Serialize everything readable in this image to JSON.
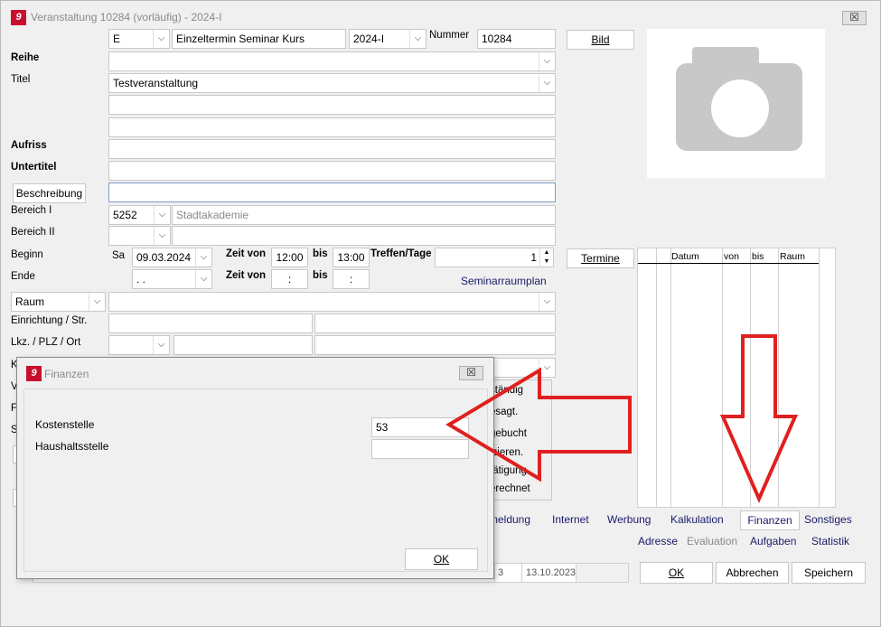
{
  "window": {
    "title": "Veranstaltung 10284 (vorläufig) - 2024-I",
    "close_label": "☒"
  },
  "header_row": {
    "kind": "E",
    "type": "Einzeltermin Seminar Kurs",
    "semester": "2024-I",
    "nummer_label": "Nummer",
    "nummer": "10284",
    "bild_label": "Bild"
  },
  "labels": {
    "reihe": "Reihe",
    "titel": "Titel",
    "aufriss": "Aufriss",
    "untertitel": "Untertitel",
    "beschreibung": "Beschreibung",
    "bereich1": "Bereich I",
    "bereich2": "Bereich II",
    "beginn": "Beginn",
    "ende": "Ende",
    "zeit_von": "Zeit von",
    "bis": "bis",
    "treffen": "Treffen/Tage",
    "termine": "Termine",
    "seminarraumplan": "Seminarraumplan",
    "raum": "Raum",
    "einrichtung": "Einrichtung / Str.",
    "plz": "Lkz. / PLZ / Ort"
  },
  "values": {
    "titel": "Testveranstaltung",
    "bereich1_code": "5252",
    "bereich1_name": "Stadtakademie",
    "beginn_day": "Sa",
    "beginn_date": "09.03.2024",
    "beginn_from": "12:00",
    "beginn_to": "13:00",
    "treffen": "1",
    "ende_date": " .  .",
    "ende_from": ":",
    "ende_to": ":"
  },
  "termin_grid": {
    "columns": [
      "Datum",
      "von",
      "bis",
      "Raum"
    ]
  },
  "status_items": [
    "ständig",
    "esagt.",
    "gebucht",
    "izieren.",
    "tätigung",
    "erechnet"
  ],
  "tabs_row1": [
    "meldung",
    "Internet",
    "Werbung",
    "Kalkulation",
    "Finanzen",
    "Sonstiges"
  ],
  "tabs_row2": [
    "Adresse",
    "Evaluation",
    "Aufgaben",
    "Statistik"
  ],
  "bottom": {
    "cell_a": "3",
    "date": "13.10.2023"
  },
  "buttons": {
    "ok": "OK",
    "abbrechen": "Abbrechen",
    "speichern": "Speichern"
  },
  "left_stubs": [
    "K",
    "V",
    "F",
    "S"
  ],
  "dialog": {
    "title": "Finanzen",
    "kostenstelle_label": "Kostenstelle",
    "kostenstelle_value": "53",
    "haushaltsstelle_label": "Haushaltsstelle",
    "haushaltsstelle_value": "",
    "ok_label": "OK"
  },
  "colors": {
    "accent_red": "#e02020",
    "logo_red": "#c8102e"
  }
}
